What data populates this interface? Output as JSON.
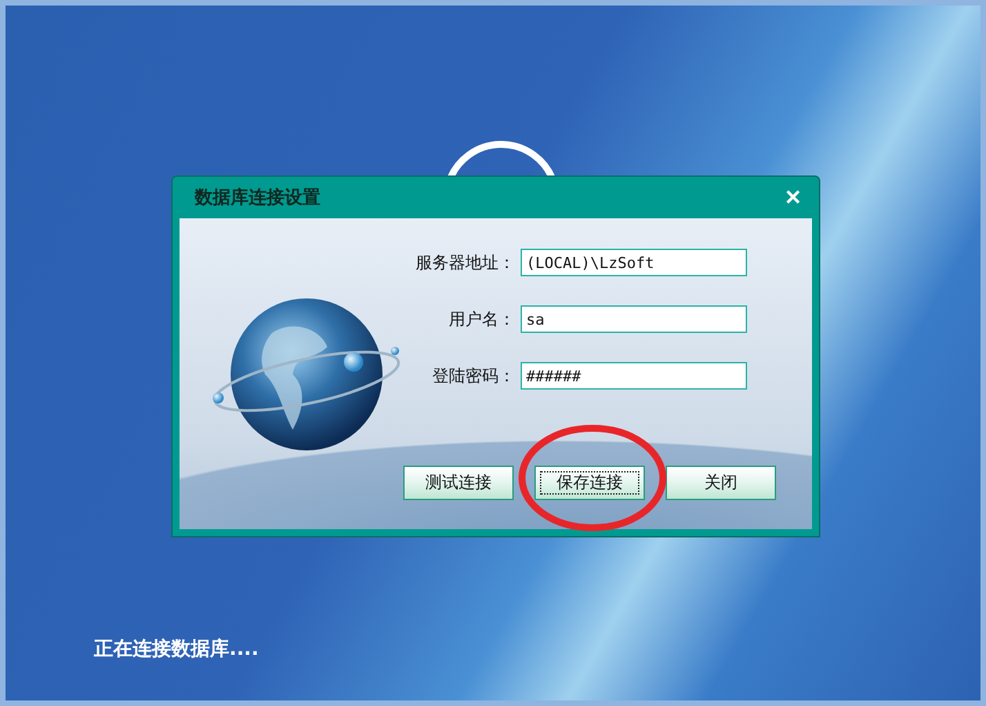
{
  "dialog": {
    "title": "数据库连接设置",
    "close": "✕",
    "fields": [
      {
        "label": "服务器地址：",
        "value": "(LOCAL)\\LzSoft"
      },
      {
        "label": "用户名：",
        "value": "sa"
      },
      {
        "label": "登陆密码：",
        "value": "######"
      }
    ],
    "buttons": [
      {
        "label": "测试连接",
        "focused": false
      },
      {
        "label": "保存连接",
        "focused": true
      },
      {
        "label": "关闭",
        "focused": false
      }
    ]
  },
  "status_text": "正在连接数据库...."
}
